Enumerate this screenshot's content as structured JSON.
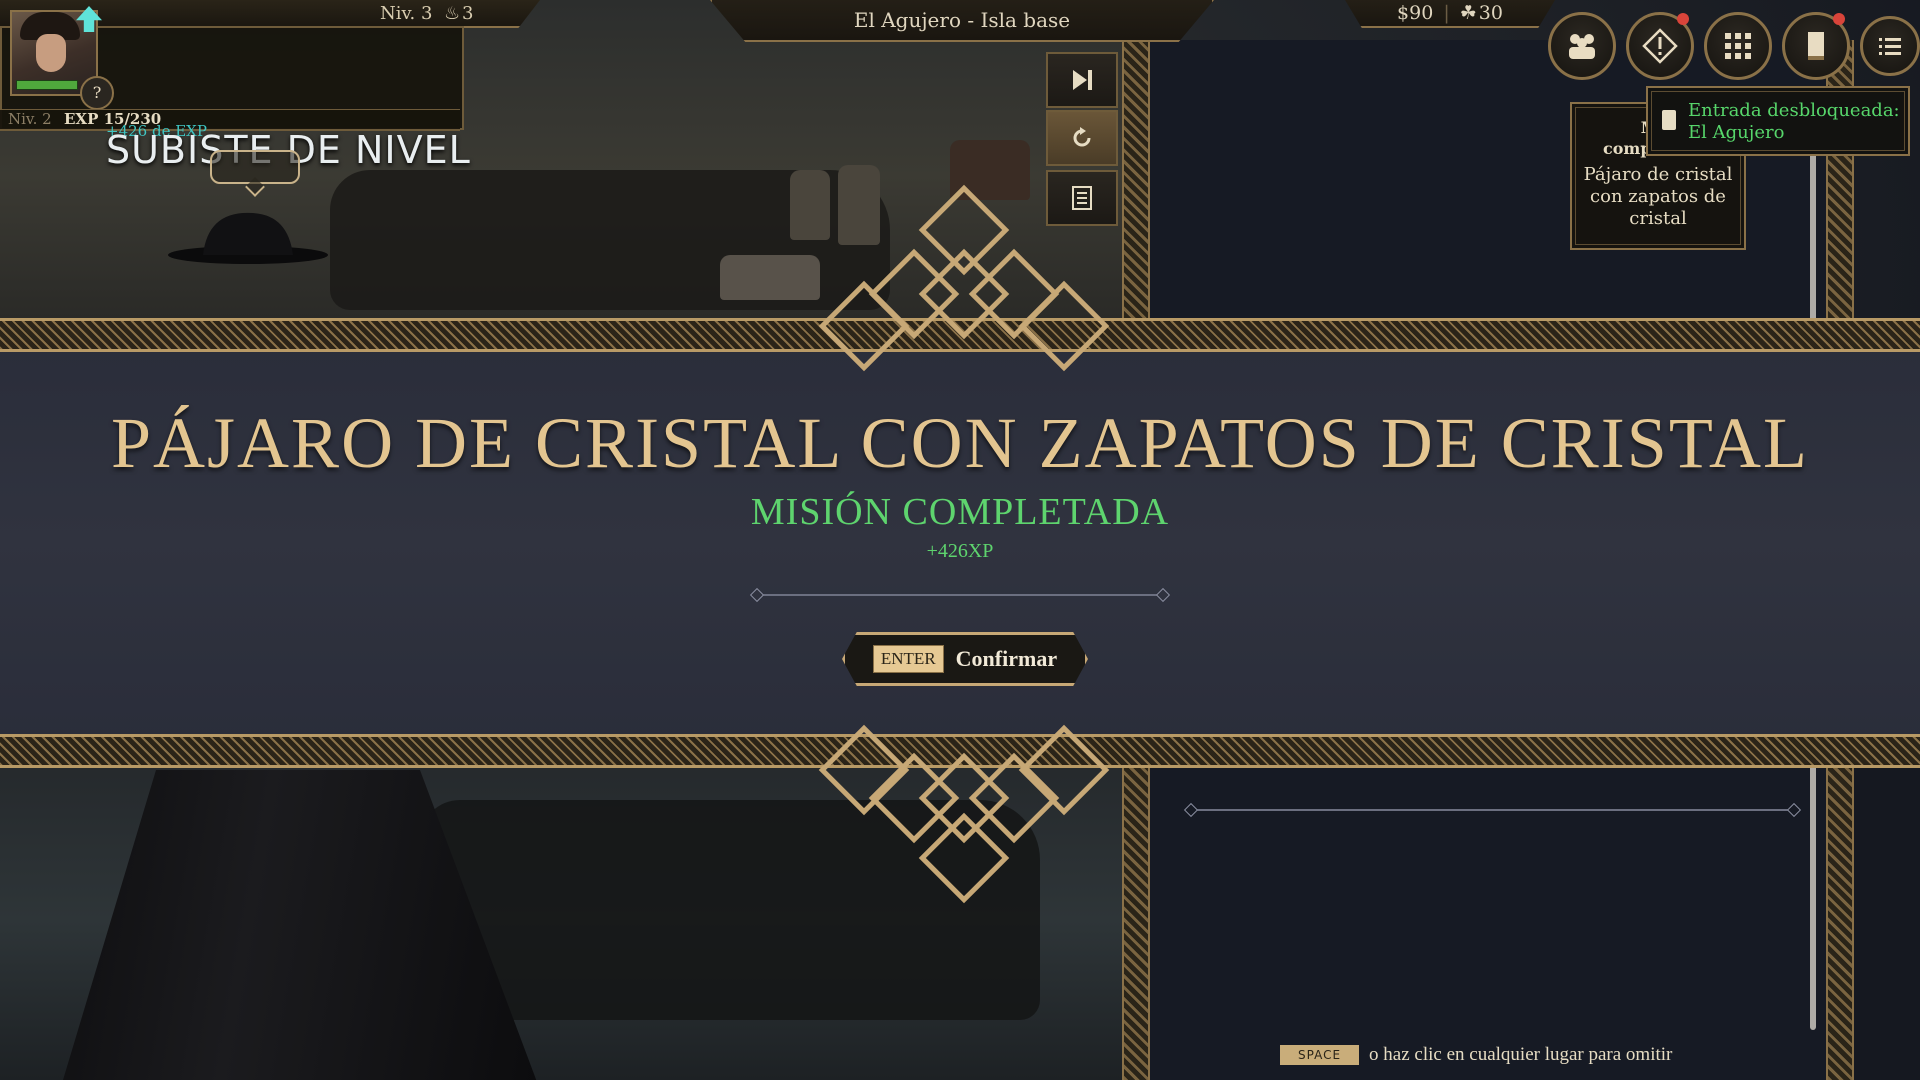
{
  "top_bar": {
    "level_label": "Niv. 3",
    "streak_value": "3",
    "location": "El Agujero - Isla base",
    "money": "$90",
    "resource_value": "30"
  },
  "player": {
    "help_icon": "?",
    "level_small": "Niv. 2",
    "exp": "EXP 15/230",
    "exp_gain": "+426 de EXP",
    "level_up_text": "SUBISTE DE NIVEL"
  },
  "side_buttons": {
    "skip_icon": "skip-forward-icon",
    "replay_icon": "replay-icon",
    "log_icon": "log-icon"
  },
  "icon_buttons": [
    {
      "name": "party-icon"
    },
    {
      "name": "alert-icon",
      "notification": true
    },
    {
      "name": "inventory-grid-icon"
    },
    {
      "name": "journal-icon",
      "notification": true
    },
    {
      "name": "menu-icon"
    }
  ],
  "notifications": {
    "quest_head": "M...",
    "quest_head_line2": "completada:",
    "quest_body": "Pájaro de cristal con zapatos de cristal",
    "entry_text_1": "Entrada desbloqueada:",
    "entry_text_2": "El Agujero"
  },
  "quest_banner": {
    "title": "PÁJARO DE CRISTAL CON ZAPATOS DE CRISTAL",
    "status": "MISIÓN COMPLETADA",
    "xp": "+426XP",
    "confirm_key": "ENTER",
    "confirm_label": "Confirmar"
  },
  "skip_hint": {
    "key": "SPACE",
    "text": "o haz clic en cualquier lugar para omitir"
  },
  "colors": {
    "gold": "#c7a876",
    "quest_green": "#5ed46e",
    "exp_teal": "#3fc6c3",
    "panel_dark": "#161a24"
  }
}
